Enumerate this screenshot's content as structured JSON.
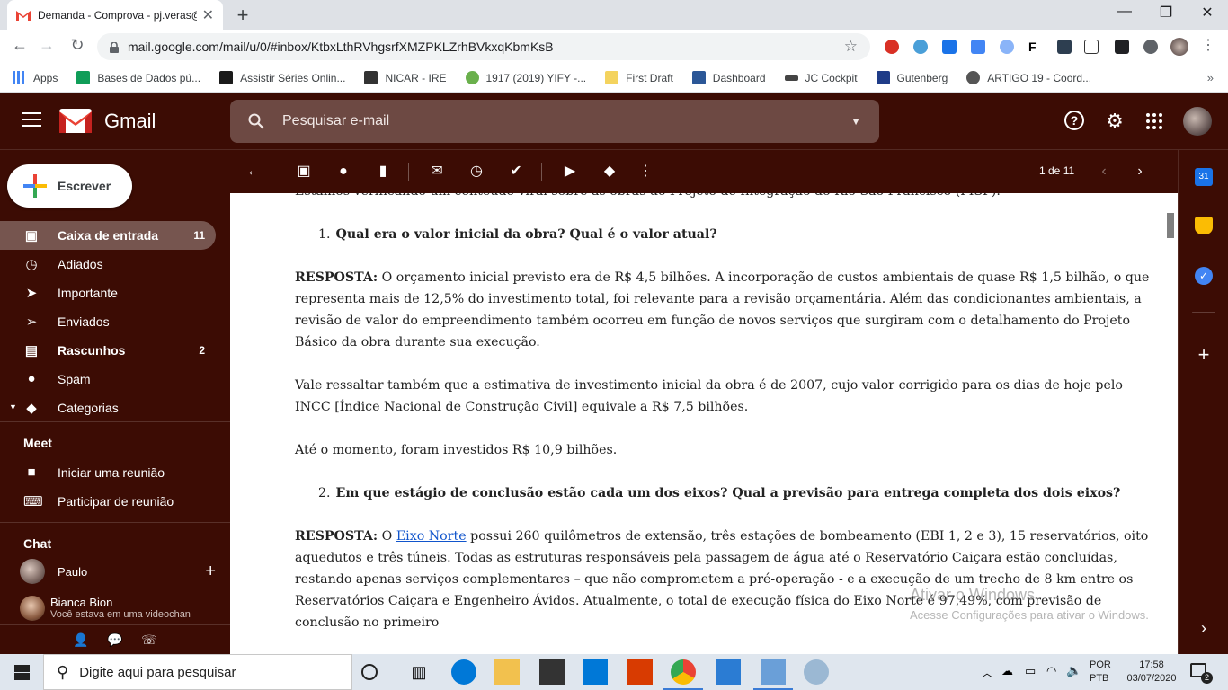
{
  "browser": {
    "tab_title": "Demanda - Comprova - pj.veras@",
    "url": "mail.google.com/mail/u/0/#inbox/KtbxLthRVhgsrfXMZPKLZrhBVkxqKbmKsB",
    "bookmarks": [
      {
        "label": "Apps",
        "color": "#4285f4"
      },
      {
        "label": "Bases de Dados pú...",
        "color": "#0f9d58"
      },
      {
        "label": "Assistir Séries Onlin...",
        "color": "#1a1a1a"
      },
      {
        "label": "NICAR - IRE",
        "color": "#333333"
      },
      {
        "label": "1917 (2019) YIFY -...",
        "color": "#6ab04c"
      },
      {
        "label": "First Draft",
        "color": "#f4d35e"
      },
      {
        "label": "Dashboard",
        "color": "#2b5797"
      },
      {
        "label": "JC Cockpit",
        "color": "#444444"
      },
      {
        "label": "Gutenberg",
        "color": "#1f3c88"
      },
      {
        "label": "ARTIGO 19 - Coord...",
        "color": "#555555"
      }
    ]
  },
  "gmail": {
    "product_name": "Gmail",
    "search_placeholder": "Pesquisar e-mail",
    "compose_label": "Escrever",
    "nav": [
      {
        "label": "Caixa de entrada",
        "count": "11",
        "icon": "inbox-icon",
        "active": true
      },
      {
        "label": "Adiados",
        "count": "",
        "icon": "clock-icon"
      },
      {
        "label": "Importante",
        "count": "",
        "icon": "important-icon"
      },
      {
        "label": "Enviados",
        "count": "",
        "icon": "send-icon"
      },
      {
        "label": "Rascunhos",
        "count": "2",
        "icon": "draft-icon"
      },
      {
        "label": "Spam",
        "count": "",
        "icon": "spam-icon"
      },
      {
        "label": "Categorias",
        "count": "",
        "icon": "label-icon"
      }
    ],
    "meet": {
      "heading": "Meet",
      "items": [
        "Iniciar uma reunião",
        "Participar de reunião"
      ]
    },
    "chat": {
      "heading": "Chat",
      "user": "Paulo",
      "contact_name": "Bianca Bion",
      "contact_status": "Você estava em uma videochan"
    },
    "pager": "1 de 11"
  },
  "message": {
    "intro": "Estamos verificando um conteúdo viral sobre as obras do Projeto de Integração do Rio São Francisco (PISF).",
    "q1_num": "1.",
    "q1": "Qual era o valor inicial da obra? Qual é o valor atual?",
    "a1_label": "RESPOSTA:",
    "a1": " O orçamento inicial previsto era de R$ 4,5 bilhões. A incorporação de custos ambientais de quase R$ 1,5 bilhão, o que representa mais de 12,5% do investimento total, foi relevante para a revisão orçamentária. Além das condicionantes ambientais, a revisão de valor do empreendimento também ocorreu em função de novos serviços que surgiram com o detalhamento do Projeto Básico da obra durante sua execução.",
    "p2": "Vale ressaltar também que a estimativa de investimento inicial da obra é de 2007, cujo valor corrigido para os dias de hoje pelo INCC [Índice Nacional de Construção Civil] equivale a R$ 7,5 bilhões.",
    "p3": "Até o momento, foram investidos R$ 10,9 bilhões.",
    "q2_num": "2.",
    "q2": "Em que estágio de conclusão estão cada um dos eixos? Qual a previsão para entrega completa dos dois eixos?",
    "a2_label": "RESPOSTA:",
    "a2_pre": " O ",
    "a2_link": "Eixo Norte",
    "a2": " possui 260 quilômetros de extensão, três estações de bombeamento (EBI 1, 2 e 3), 15 reservatórios, oito aquedutos e três túneis. Todas as estruturas responsáveis pela passagem de água até o Reservatório Caiçara estão concluídas, restando apenas serviços complementares – que não comprometem a pré-operação - e a execução de um trecho de 8 km entre os Reservatórios Caiçara e Engenheiro Ávidos. Atualmente, o total de execução física do Eixo Norte é 97,49%, com previsão de conclusão no primeiro"
  },
  "watermark": {
    "line1": "Ativar o Windows",
    "line2": "Acesse Configurações para ativar o Windows."
  },
  "taskbar": {
    "search_placeholder": "Digite aqui para pesquisar",
    "lang1": "POR",
    "lang2": "PTB",
    "time": "17:58",
    "date": "03/07/2020",
    "notifications": "2"
  }
}
